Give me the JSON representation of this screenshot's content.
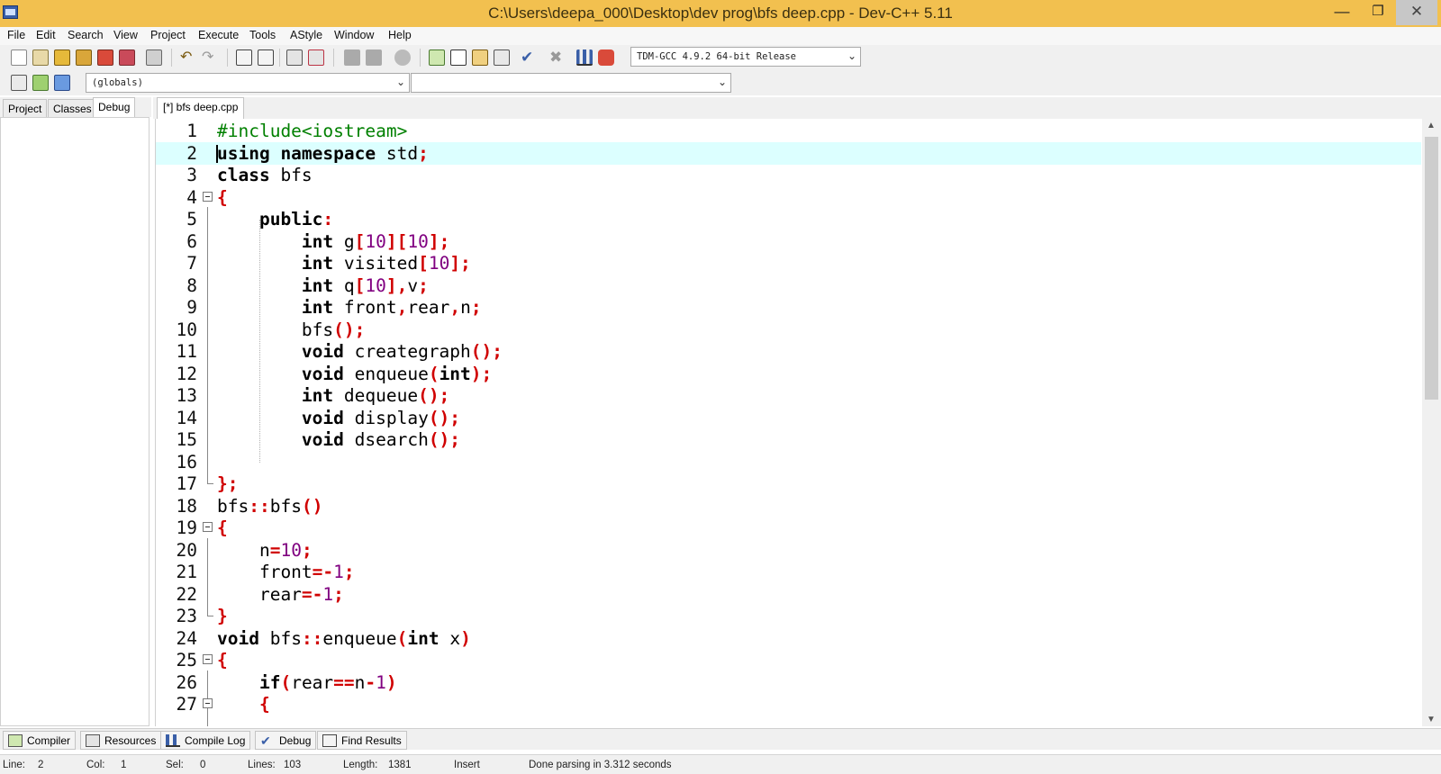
{
  "window": {
    "title": "C:\\Users\\deepa_000\\Desktop\\dev prog\\bfs deep.cpp - Dev-C++ 5.11",
    "minimize": "—",
    "maximize": "❐",
    "close": "✕"
  },
  "menu": [
    "File",
    "Edit",
    "Search",
    "View",
    "Project",
    "Execute",
    "Tools",
    "AStyle",
    "Window",
    "Help"
  ],
  "toolbar": {
    "compiler_select": "TDM-GCC 4.9.2 64-bit Release",
    "scope_select": "(globals)",
    "member_select": ""
  },
  "left_panel": {
    "tabs": [
      "Project",
      "Classes",
      "Debug"
    ],
    "active_tab": "Debug"
  },
  "editor": {
    "tab_label": "[*] bfs deep.cpp",
    "current_line": 2,
    "lines": [
      "1",
      "2",
      "3",
      "4",
      "5",
      "6",
      "7",
      "8",
      "9",
      "10",
      "11",
      "12",
      "13",
      "14",
      "15",
      "16",
      "17",
      "18",
      "19",
      "20",
      "21",
      "22",
      "23",
      "24",
      "25",
      "26",
      "27"
    ]
  },
  "bottom_tabs": [
    "Compiler",
    "Resources",
    "Compile Log",
    "Debug",
    "Find Results"
  ],
  "status": {
    "line_label": "Line:",
    "line_value": "2",
    "col_label": "Col:",
    "col_value": "1",
    "sel_label": "Sel:",
    "sel_value": "0",
    "lines_label": "Lines:",
    "lines_value": "103",
    "length_label": "Length:",
    "length_value": "1381",
    "mode": "Insert",
    "message": "Done parsing in 3.312 seconds"
  },
  "colors": {
    "titlebar": "#f2c04f",
    "current_line": "#dcffff",
    "keyword": "#000000",
    "preprocessor": "#008000",
    "symbol": "#d00000",
    "number": "#800080"
  }
}
